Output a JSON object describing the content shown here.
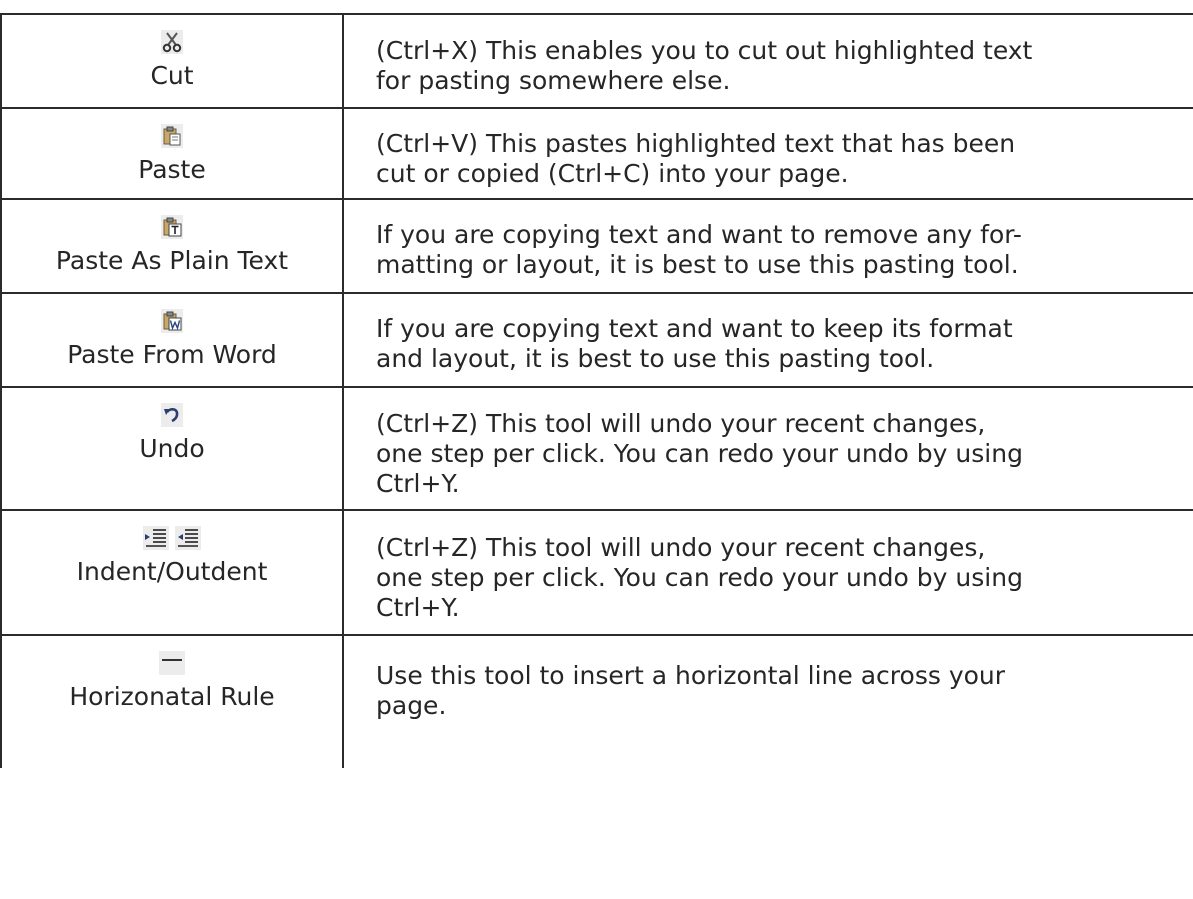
{
  "rows": [
    {
      "icon": "scissors-icon",
      "name": "Cut",
      "description": "(Ctrl+X) This enables you to cut out highlighted text\nfor pasting somewhere else."
    },
    {
      "icon": "paste-icon",
      "name": "Paste",
      "description": "(Ctrl+V) This pastes highlighted text that has been\ncut or copied (Ctrl+C) into your page."
    },
    {
      "icon": "paste-plain-text-icon",
      "name": "Paste As Plain Text",
      "description": "If you are copying text and want to remove any for-\nmatting or layout, it is best to use this pasting tool."
    },
    {
      "icon": "paste-from-word-icon",
      "name": "Paste From Word",
      "description": "If you are copying text and want to keep its format\nand layout, it is best to use this pasting tool."
    },
    {
      "icon": "undo-icon",
      "name": "Undo",
      "description": "(Ctrl+Z) This tool will undo your recent changes,\none step per click. You can redo your undo by using\nCtrl+Y."
    },
    {
      "icon": "indent-outdent-icon",
      "name": "Indent/Outdent",
      "description": "(Ctrl+Z) This tool will undo your recent changes,\none step per click. You can redo your undo by using\nCtrl+Y."
    },
    {
      "icon": "horizontal-rule-icon",
      "name": "Horizonatal Rule",
      "description": "Use this tool to insert a horizontal line across your\npage."
    }
  ],
  "colors": {
    "text": "#262626",
    "border": "#2b2b2b",
    "icon_bg": "#ececec"
  }
}
